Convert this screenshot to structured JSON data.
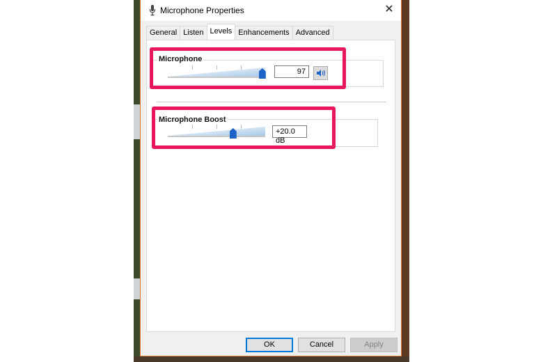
{
  "window": {
    "title": "Microphone Properties",
    "title_icon": "microphone-icon",
    "close_glyph": "✕"
  },
  "tabs": [
    {
      "label": "General"
    },
    {
      "label": "Listen"
    },
    {
      "label": "Levels",
      "active": true
    },
    {
      "label": "Enhancements"
    },
    {
      "label": "Advanced"
    }
  ],
  "levels": {
    "microphone": {
      "label": "Microphone",
      "value": "97",
      "level_percent": 97,
      "mute_icon": "speaker-icon"
    },
    "boost": {
      "label": "Microphone Boost",
      "value": "+20.0 dB",
      "level_fraction": 0.67
    }
  },
  "buttons": {
    "ok": "OK",
    "cancel": "Cancel",
    "apply": "Apply"
  },
  "colors": {
    "highlight": "#e8175d",
    "slider_thumb": "#1c63c8",
    "window_border": "#e07b39"
  }
}
